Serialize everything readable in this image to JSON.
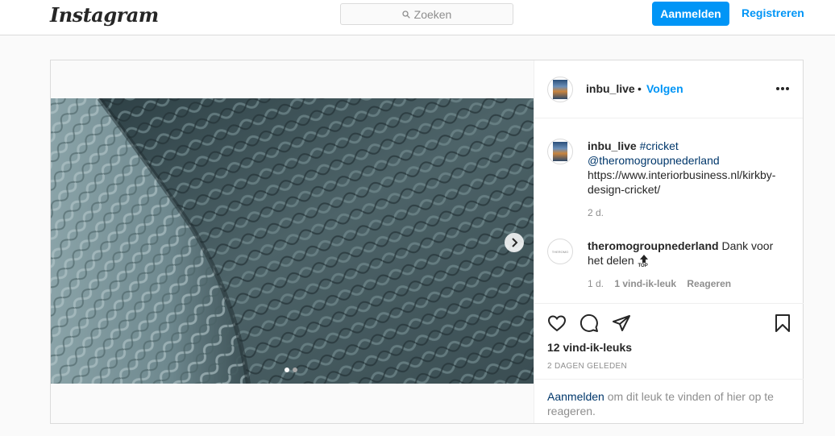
{
  "header": {
    "logo": "Instagram",
    "search_placeholder": "Zoeken",
    "login_label": "Aanmelden",
    "register_label": "Registreren"
  },
  "post": {
    "owner": "inbu_live",
    "bullet": "•",
    "follow_label": "Volgen",
    "carousel": {
      "slide_count": 2,
      "active_slide": 1
    },
    "caption": {
      "author": "inbu_live",
      "hashtag": "#cricket",
      "mention": "@theromogroupnederland",
      "url_line1": "https://www.interiorbusiness.nl/kirkby-",
      "url_line2": "design-cricket/",
      "age": "2 d."
    },
    "comment": {
      "author": "theromogroupnederland",
      "text_line1": "Dank voor",
      "text_line2": "het delen",
      "emoji_label": "TOP",
      "age": "1 d.",
      "likes": "1 vind-ik-leuk",
      "reply_label": "Reageren"
    },
    "likes": "12 vind-ik-leuks",
    "date": "2 DAGEN GELEDEN",
    "login_link": "Aanmelden",
    "login_text": " om dit leuk te vinden of hier op te reageren."
  },
  "icons": {
    "search": "search-icon",
    "next": "chevron-right-icon",
    "more": "more-options-icon",
    "like": "heart-icon",
    "comment": "comment-icon",
    "share": "send-icon",
    "save": "bookmark-icon"
  },
  "colors": {
    "accent": "#0095f6",
    "link_dark": "#00376b",
    "muted": "#8e8e8e",
    "border": "#dbdbdb"
  }
}
